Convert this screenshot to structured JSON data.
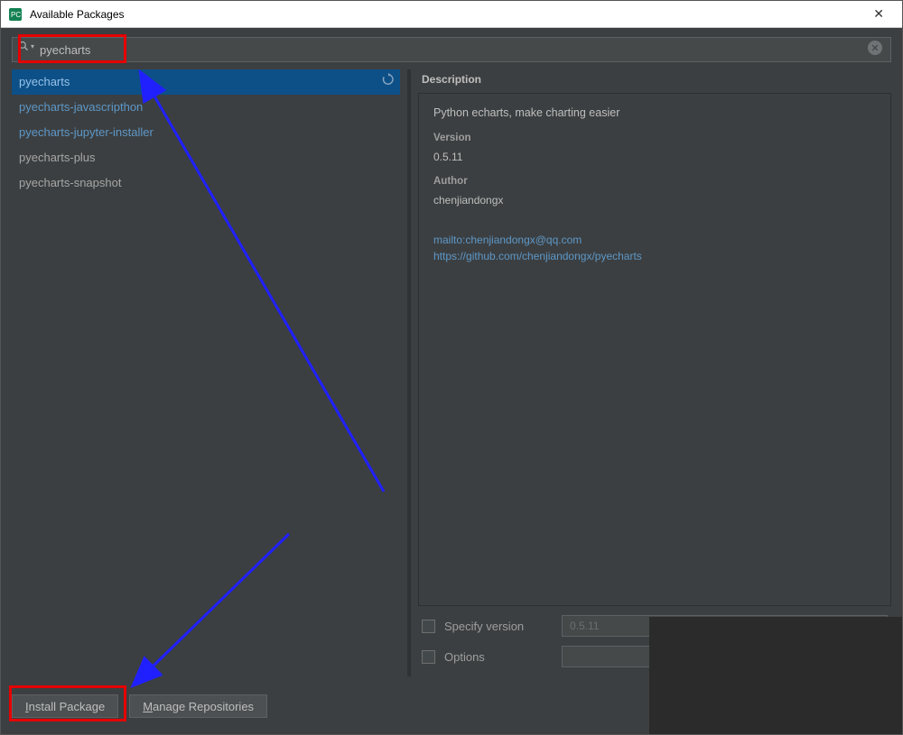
{
  "window": {
    "title": "Available Packages"
  },
  "search": {
    "value": "pyecharts"
  },
  "packages": [
    {
      "name": "pyecharts",
      "selected": true,
      "link": true,
      "refresh": true
    },
    {
      "name": "pyecharts-javascripthon",
      "selected": false,
      "link": true
    },
    {
      "name": "pyecharts-jupyter-installer",
      "selected": false,
      "link": true
    },
    {
      "name": "pyecharts-plus",
      "selected": false,
      "link": false
    },
    {
      "name": "pyecharts-snapshot",
      "selected": false,
      "link": false
    }
  ],
  "description": {
    "header": "Description",
    "summary": "Python echarts, make charting easier",
    "version_label": "Version",
    "version": "0.5.11",
    "author_label": "Author",
    "author": "chenjiandongx",
    "mailto": "mailto:chenjiandongx@qq.com",
    "url": "https://github.com/chenjiandongx/pyecharts"
  },
  "options": {
    "specify_version_label": "Specify version",
    "specify_version_value": "0.5.11",
    "options_label": "Options",
    "options_value": ""
  },
  "buttons": {
    "install": "nstall Package",
    "install_ul": "I",
    "manage": "anage Repositories",
    "manage_ul": "M"
  }
}
